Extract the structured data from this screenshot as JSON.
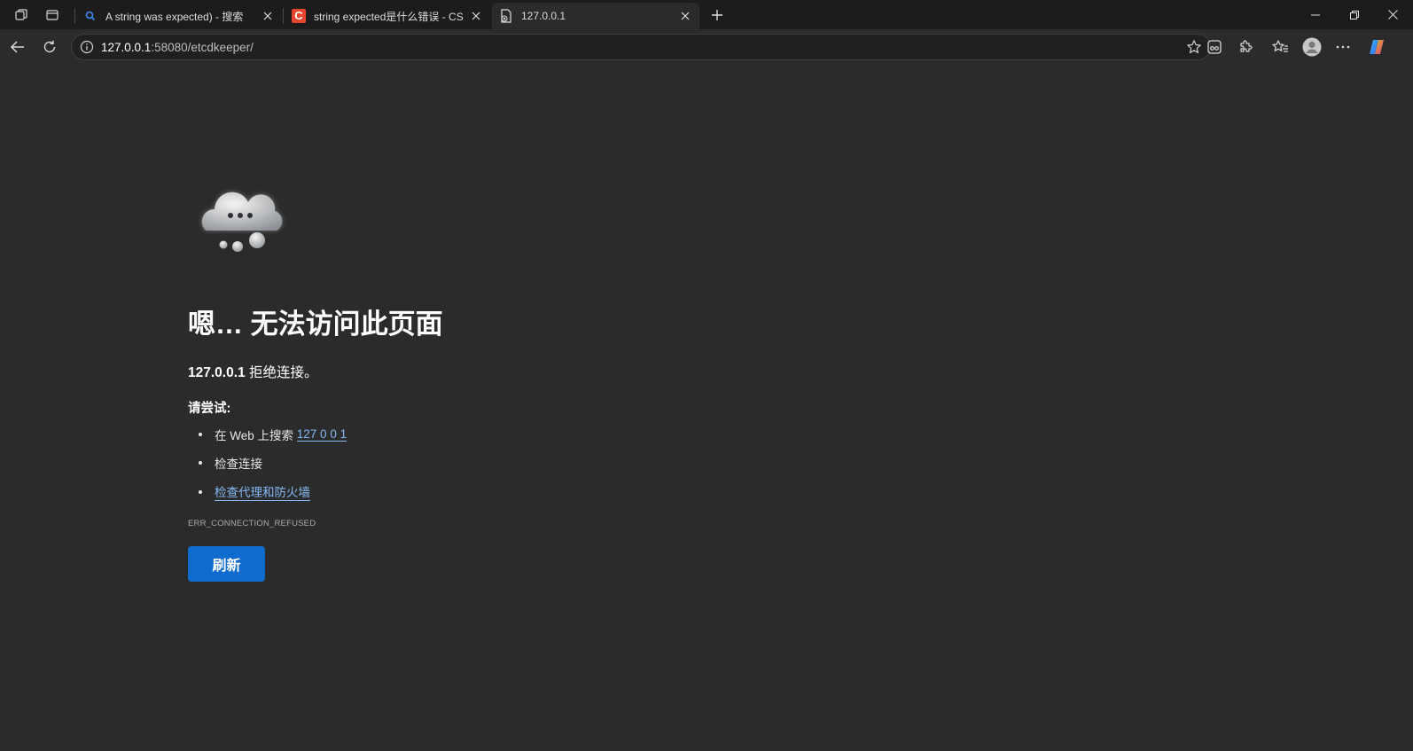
{
  "browser": {
    "tabs": [
      {
        "title": "A string was expected) - 搜索",
        "favicon": "search-icon"
      },
      {
        "title": "string expected是什么错误 - CSDN",
        "favicon": "csdn-logo-icon"
      },
      {
        "title": "127.0.0.1",
        "favicon": "error-page-icon",
        "active": true
      }
    ],
    "address": {
      "host": "127.0.0.1",
      "port_path": ":58080/etcdkeeper/"
    }
  },
  "error_page": {
    "heading": "嗯… 无法访问此页面",
    "host": "127.0.0.1",
    "message": " 拒绝连接。",
    "try_label": "请尝试:",
    "suggestions": {
      "search_prefix": "在 Web 上搜索",
      "search_link": "127 0 0 1",
      "check_connection": "检查连接",
      "check_proxy": "检查代理和防火墙"
    },
    "error_code": "ERR_CONNECTION_REFUSED",
    "refresh_label": "刷新"
  },
  "colors": {
    "accent": "#0f6cce",
    "link": "#86b8f5",
    "page_bg": "#2b2b2b",
    "titlebar_bg": "#1c1c1c"
  }
}
